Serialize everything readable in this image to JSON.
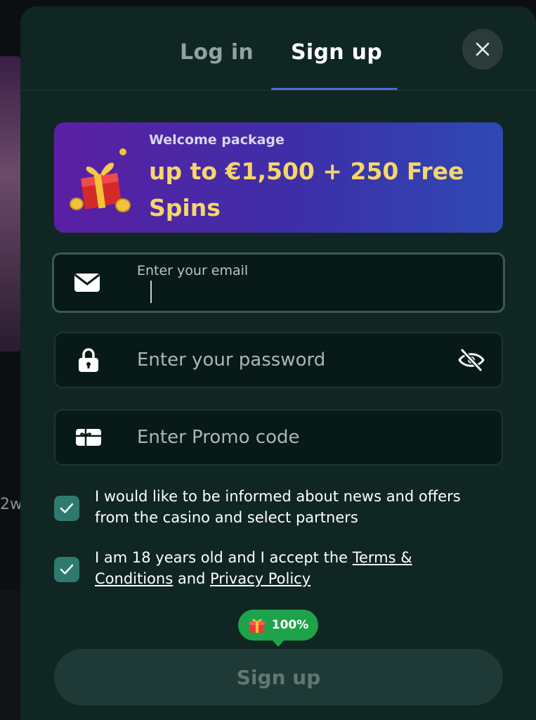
{
  "background": {
    "partial_text": "2w"
  },
  "tabs": {
    "login_label": "Log in",
    "signup_label": "Sign up",
    "active": "signup"
  },
  "banner": {
    "subtitle": "Welcome package",
    "title": "up to €1,500 + 250 Free Spins"
  },
  "form": {
    "email_label": "Enter your email",
    "email_value": "",
    "password_placeholder": "Enter your password",
    "promo_placeholder": "Enter Promo code"
  },
  "checkboxes": {
    "news": {
      "checked": true,
      "text": "I would like to be informed about news and offers from the casino and select partners"
    },
    "age": {
      "checked": true,
      "text_before": "I am 18 years old and I accept the ",
      "terms_link": "Terms & Conditions",
      "text_middle": " and ",
      "privacy_link": "Privacy Policy"
    }
  },
  "progress_badge": {
    "value": "100%",
    "icon": "gift-icon"
  },
  "submit": {
    "label": "Sign up"
  },
  "colors": {
    "modal_bg": "#0f2622",
    "banner_start": "#5b1fa3",
    "banner_end": "#2e49b3",
    "banner_title": "#f5d66b",
    "tab_underline": "#4b6ad6",
    "checkbox": "#2e7a6e",
    "badge": "#1fa34a"
  }
}
